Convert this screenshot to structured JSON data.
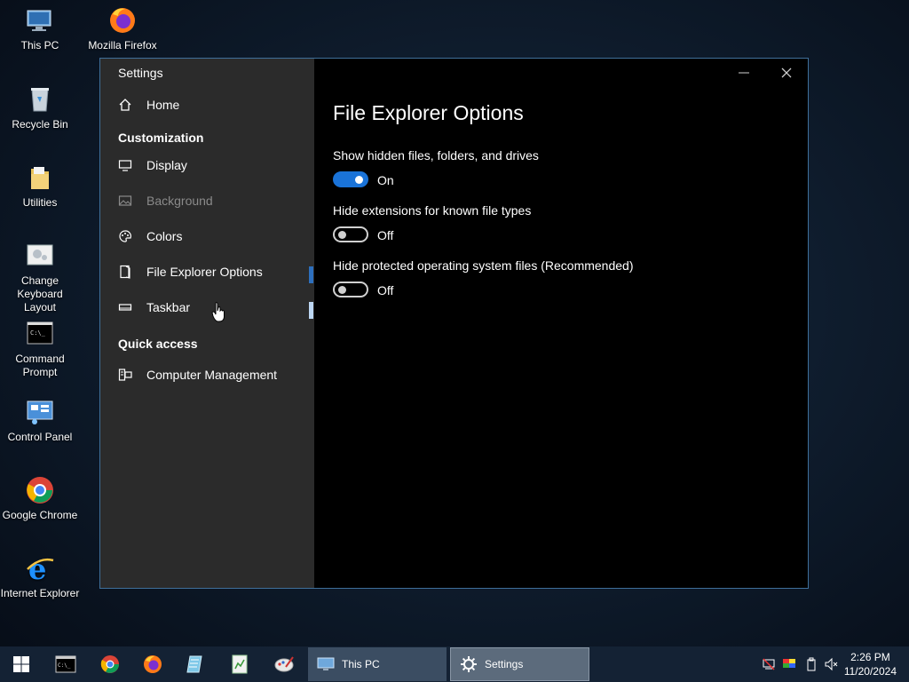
{
  "desktop": {
    "icons": [
      {
        "label": "This PC",
        "icon": "this-pc-icon"
      },
      {
        "label": "Mozilla Firefox",
        "icon": "firefox-icon"
      },
      {
        "label": "Recycle Bin",
        "icon": "recycle-bin-icon"
      },
      {
        "label": "Utilities",
        "icon": "folder-icon"
      },
      {
        "label": "Change Keyboard Layout",
        "icon": "keyboard-layout-icon"
      },
      {
        "label": "Command Prompt",
        "icon": "command-prompt-icon"
      },
      {
        "label": "Control Panel",
        "icon": "control-panel-icon"
      },
      {
        "label": "Google Chrome",
        "icon": "chrome-icon"
      },
      {
        "label": "Internet Explorer",
        "icon": "internet-explorer-icon"
      }
    ]
  },
  "window": {
    "title": "Settings",
    "controls": {
      "minimize": "—",
      "close": "✕"
    }
  },
  "sidebar": {
    "home": "Home",
    "customization_header": "Customization",
    "items": [
      {
        "label": "Display",
        "icon": "display-icon",
        "enabled": true
      },
      {
        "label": "Background",
        "icon": "picture-icon",
        "enabled": false
      },
      {
        "label": "Colors",
        "icon": "palette-icon",
        "enabled": true
      },
      {
        "label": "File Explorer Options",
        "icon": "file-explorer-icon",
        "enabled": true,
        "selected": true
      },
      {
        "label": "Taskbar",
        "icon": "taskbar-icon",
        "enabled": true
      }
    ],
    "quick_access_header": "Quick access",
    "quick_items": [
      {
        "label": "Computer Management",
        "icon": "computer-management-icon"
      }
    ]
  },
  "content": {
    "title": "File Explorer Options",
    "options": [
      {
        "label": "Show hidden files, folders, and drives",
        "state": "On",
        "on": true
      },
      {
        "label": "Hide extensions for known file types",
        "state": "Off",
        "on": false
      },
      {
        "label": "Hide protected operating system files (Recommended)",
        "state": "Off",
        "on": false
      }
    ]
  },
  "taskbar": {
    "tasks": [
      {
        "label": "This PC",
        "icon": "this-pc-icon"
      },
      {
        "label": "Settings",
        "icon": "gear-icon",
        "active": true
      }
    ],
    "pinned": [
      "command-prompt-icon",
      "chrome-icon",
      "firefox-icon",
      "notepad-icon",
      "spreadsheet-icon",
      "paint-icon"
    ],
    "clock": {
      "time": "2:26 PM",
      "date": "11/20/2024"
    },
    "colors": {
      "accent": "#1a73d8",
      "taskbar": "#142234"
    }
  }
}
